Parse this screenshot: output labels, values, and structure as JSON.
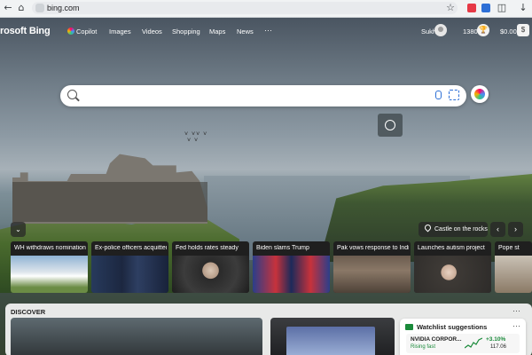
{
  "browser": {
    "url": "bing.com",
    "icons": [
      "back-icon",
      "home-icon",
      "star-icon",
      "extensions-icon",
      "download-icon"
    ]
  },
  "header": {
    "logo": "rosoft Bing",
    "nav": [
      {
        "label": "Copilot",
        "icon": "copilot-icon"
      },
      {
        "label": "Images"
      },
      {
        "label": "Videos"
      },
      {
        "label": "Shopping"
      },
      {
        "label": "Maps"
      },
      {
        "label": "News"
      }
    ],
    "more": "···",
    "user_name": "Sukh",
    "rewards_points": "1380",
    "wallet": "$0.00",
    "wallet_icon": "$"
  },
  "search": {
    "placeholder": "",
    "value": ""
  },
  "image": {
    "caption": "Castle on the rocks",
    "prev": "‹",
    "next": "›",
    "collapse": "⌄"
  },
  "news": [
    {
      "title": "WH withdraws nomination",
      "img": "news-whitehouse"
    },
    {
      "title": "Ex-police officers acquitted",
      "img": "news-officers"
    },
    {
      "title": "Fed holds rates steady",
      "img": "news-fed"
    },
    {
      "title": "Biden slams Trump",
      "img": "news-biden"
    },
    {
      "title": "Pak vows response to India",
      "img": "news-pak"
    },
    {
      "title": "Launches autism project",
      "img": "news-autism"
    },
    {
      "title": "Pope st",
      "img": "news-pope"
    }
  ],
  "discover": {
    "label": "DISCOVER",
    "more": "···"
  },
  "watchlist": {
    "title": "Watchlist suggestions",
    "more": "···",
    "stock": {
      "name": "NVIDIA CORPOR...",
      "tag": "Rising fast",
      "change": "+3.10%",
      "price": "117.06"
    }
  },
  "colors": {
    "accent": "#2d6fd6",
    "positive": "#1a8a3a"
  }
}
